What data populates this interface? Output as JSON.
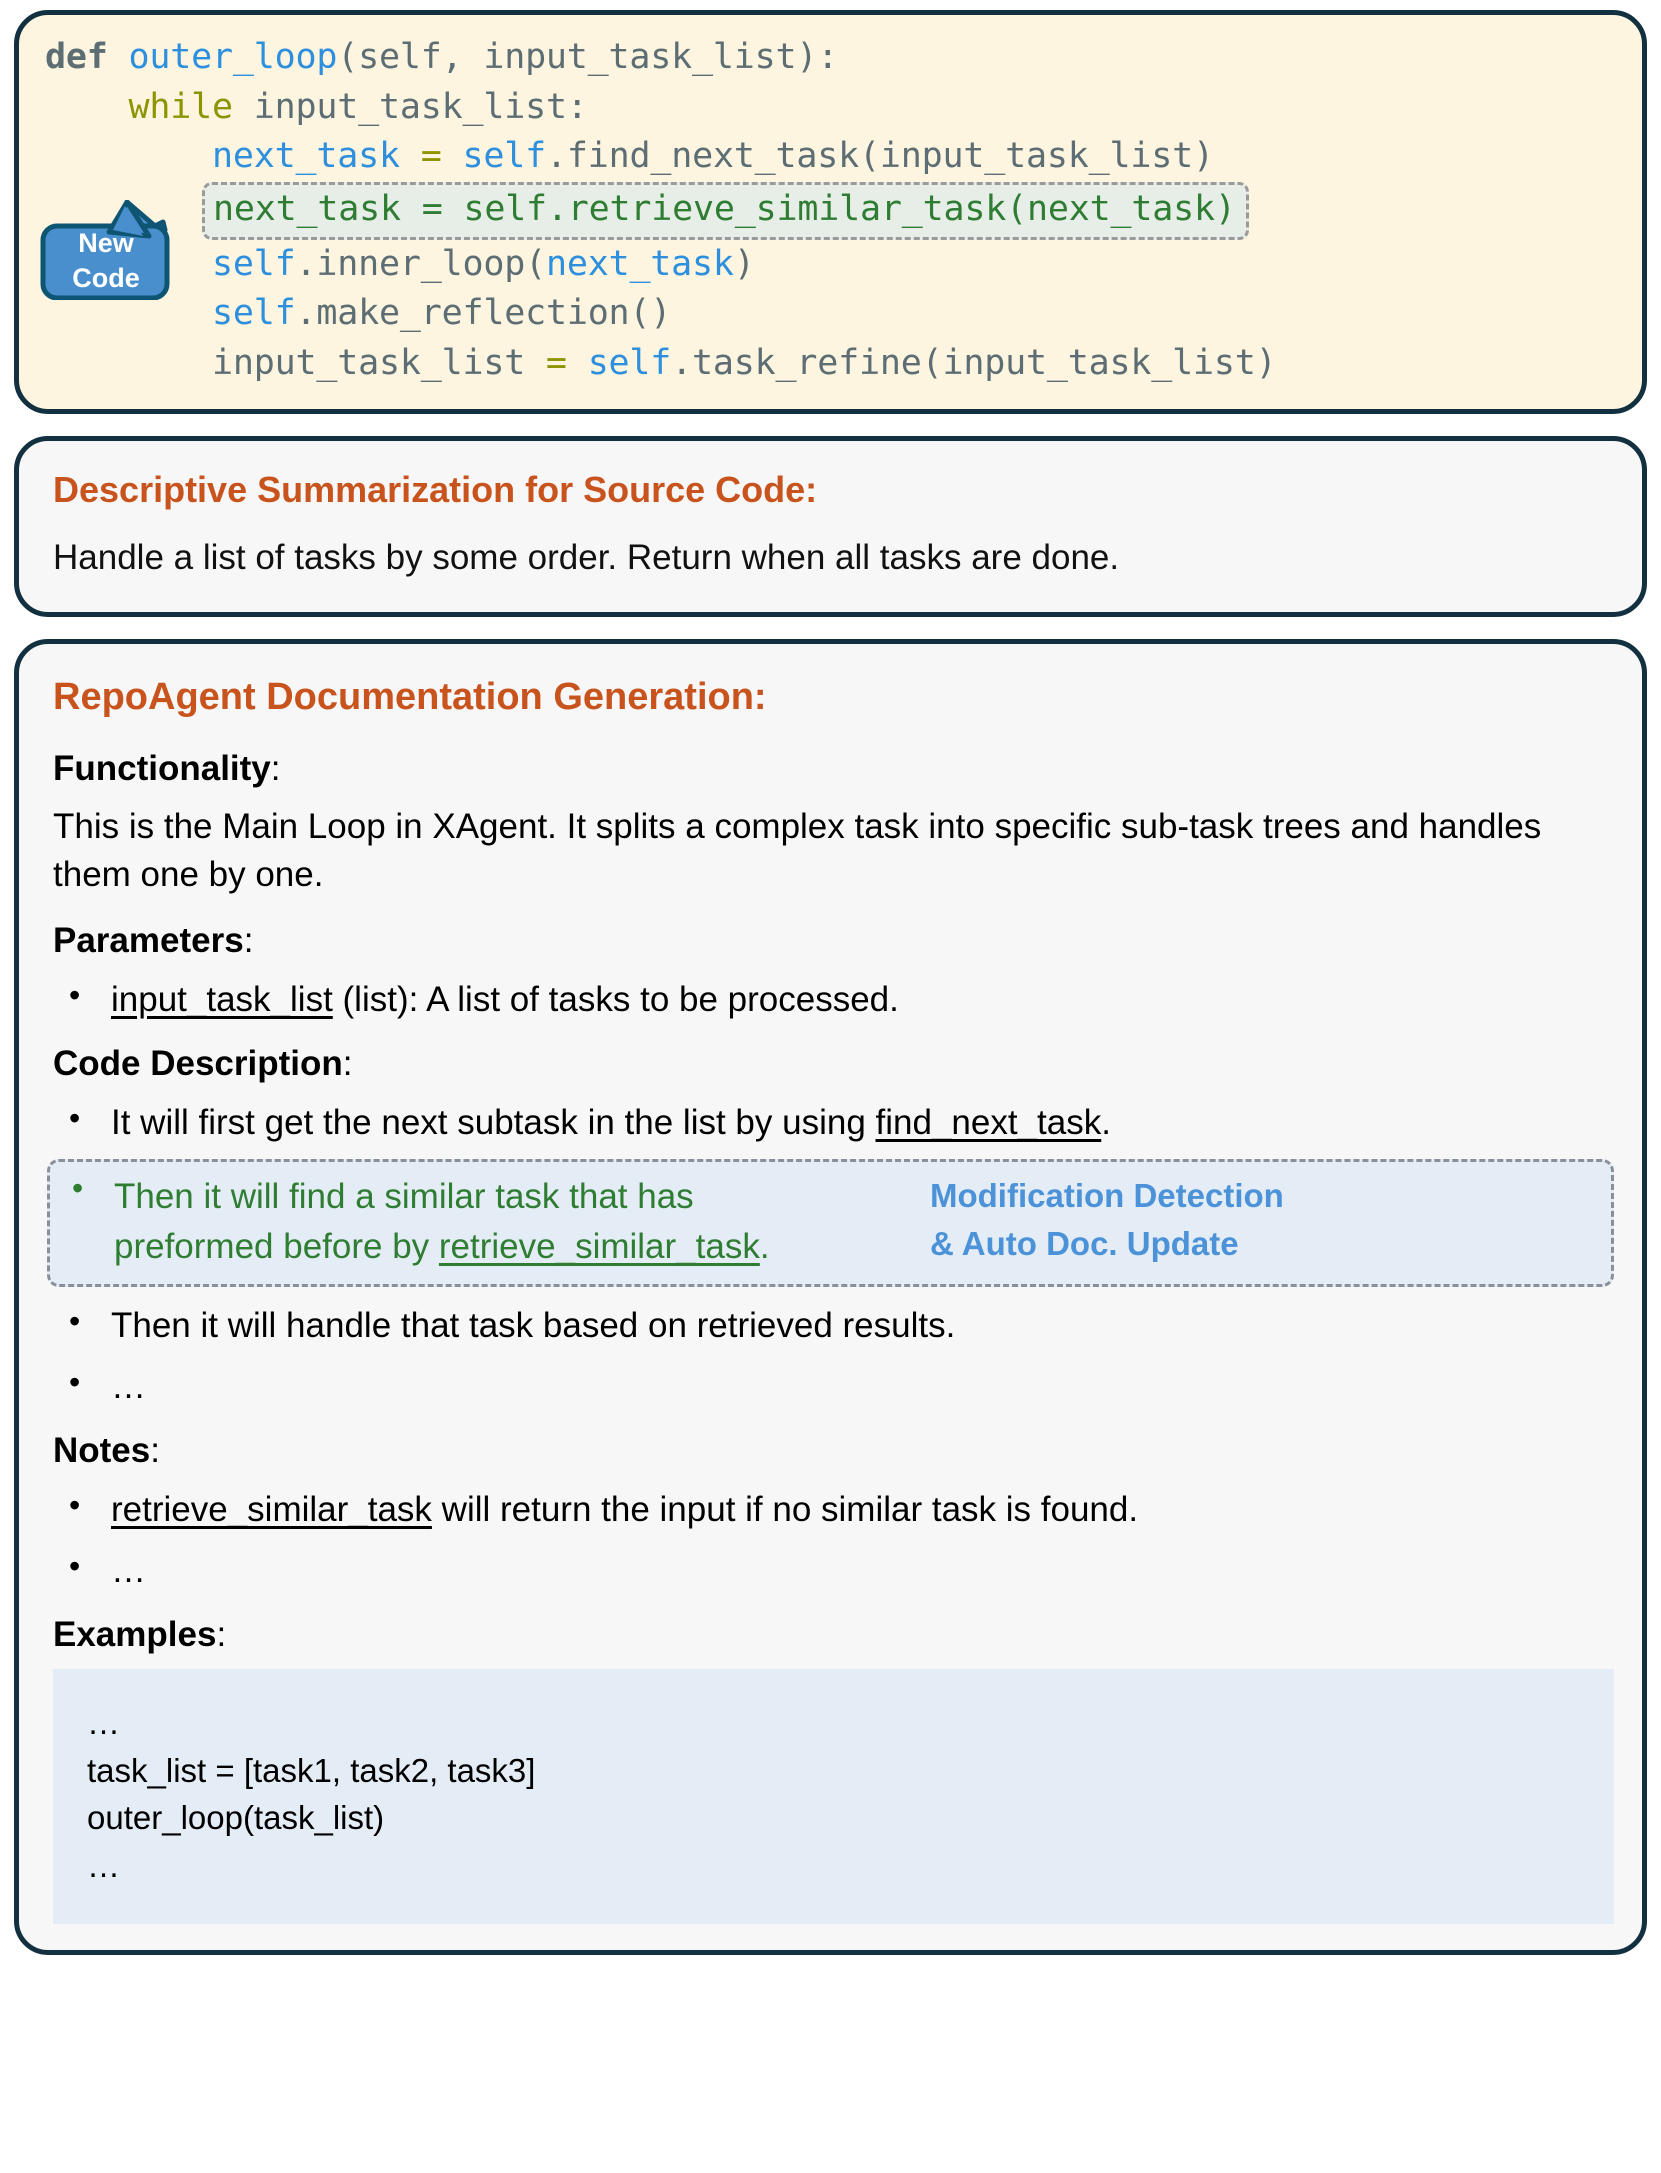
{
  "colors": {
    "card_border": "#12303f",
    "code_bg": "#fdf5df",
    "panel_bg": "#f7f7f7",
    "accent_orange": "#c8531c",
    "new_code_green": "#2e7d32",
    "callout_blue": "#4b92d8",
    "bubble_blue": "#4a8fcd",
    "highlight_blue_bg": "#e4ecf5",
    "highlight_green_bg": "#e7eee8"
  },
  "code_card": {
    "lines": [
      {
        "indent": 0,
        "highlighted": false,
        "tokens": [
          {
            "text": "def ",
            "cls": "tok-kw"
          },
          {
            "text": "outer_loop",
            "cls": "tok-fn"
          },
          {
            "text": "(self, input_task_list):",
            "cls": "tok-plain"
          }
        ]
      },
      {
        "indent": 1,
        "highlighted": false,
        "tokens": [
          {
            "text": "while ",
            "cls": "tok-kw2"
          },
          {
            "text": "input_task_list:",
            "cls": "tok-plain"
          }
        ]
      },
      {
        "indent": 2,
        "highlighted": false,
        "tokens": [
          {
            "text": "next_task",
            "cls": "tok-var"
          },
          {
            "text": " = ",
            "cls": "tok-op"
          },
          {
            "text": "self",
            "cls": "tok-self"
          },
          {
            "text": ".find_next_task(input_task_list)",
            "cls": "tok-plain"
          }
        ]
      },
      {
        "indent": 2,
        "highlighted": true,
        "tokens": [
          {
            "text": "next_task = self.retrieve_similar_task(next_task)",
            "cls": "tok-new"
          }
        ]
      },
      {
        "indent": 2,
        "highlighted": false,
        "tokens": [
          {
            "text": "self",
            "cls": "tok-self"
          },
          {
            "text": ".inner_loop(",
            "cls": "tok-plain"
          },
          {
            "text": "next_task",
            "cls": "tok-var"
          },
          {
            "text": ")",
            "cls": "tok-plain"
          }
        ]
      },
      {
        "indent": 2,
        "highlighted": false,
        "tokens": [
          {
            "text": "self",
            "cls": "tok-self"
          },
          {
            "text": ".make_reflection()",
            "cls": "tok-plain"
          }
        ]
      },
      {
        "indent": 2,
        "highlighted": false,
        "tokens": [
          {
            "text": "input_task_list",
            "cls": "tok-plain"
          },
          {
            "text": " = ",
            "cls": "tok-op"
          },
          {
            "text": "self",
            "cls": "tok-self"
          },
          {
            "text": ".task_refine(input_task_list)",
            "cls": "tok-plain"
          }
        ]
      }
    ],
    "callout": {
      "line1": "New",
      "line2": "Code"
    }
  },
  "summary_card": {
    "title": "Descriptive Summarization for Source Code:",
    "text": "Handle a list of tasks by some order.  Return when all tasks are done."
  },
  "doc_card": {
    "title": "RepoAgent Documentation Generation:",
    "functionality": {
      "heading": "Functionality",
      "colon": ":",
      "text": "This is the Main Loop in XAgent. It splits a complex task into specific sub-task trees and handles them one by one."
    },
    "parameters": {
      "heading": "Parameters",
      "colon": ":",
      "items": [
        {
          "mono": "input_task_list",
          "rest": " (list): A list of tasks to be processed."
        }
      ]
    },
    "code_description": {
      "heading": "Code Description",
      "colon": ":",
      "item1_pre": "It will first get the next subtask in the list by using ",
      "item1_mono": "find_next_task",
      "item1_post": ".",
      "highlighted_item": {
        "line1": "Then it will find a similar task that has",
        "line2_pre": "preformed before by ",
        "line2_mono": "retrieve_similar_task",
        "line2_post": ".",
        "label_line1": "Modification Detection",
        "label_line2": "& Auto Doc. Update"
      },
      "item3": "Then it will handle that task based on retrieved results.",
      "item4": "…"
    },
    "notes": {
      "heading": "Notes",
      "colon": ":",
      "item1_mono": "retrieve_similar_task",
      "item1_rest": " will return the input if no similar task is found.",
      "item2": "…"
    },
    "examples": {
      "heading": "Examples",
      "colon": ":",
      "lines": [
        "…",
        "task_list = [task1, task2, task3]",
        "outer_loop(task_list)",
        "…"
      ]
    }
  }
}
